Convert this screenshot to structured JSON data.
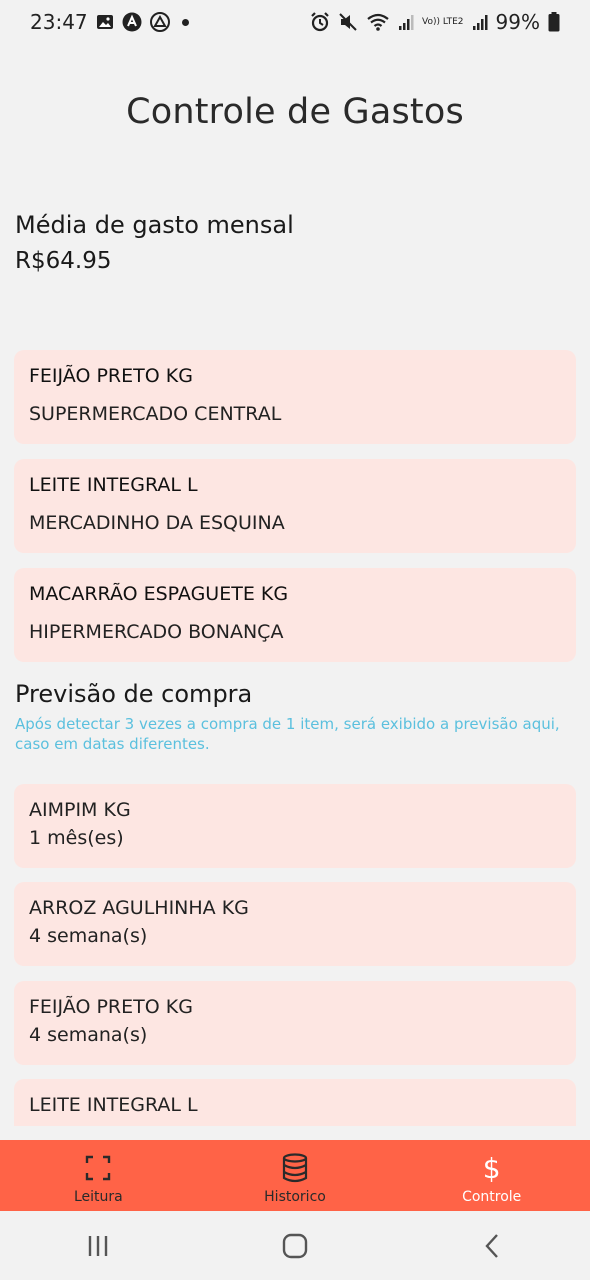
{
  "status_bar": {
    "time": "23:47",
    "battery": "99%",
    "network_label": "Vo)) LTE2"
  },
  "header": {
    "title": "Controle de Gastos"
  },
  "summary": {
    "label": "Média de gasto mensal",
    "value": "R$64.95"
  },
  "top_items": [
    {
      "name": "FEIJÃO PRETO KG",
      "store": "SUPERMERCADO CENTRAL"
    },
    {
      "name": "LEITE INTEGRAL L",
      "store": "MERCADINHO DA ESQUINA"
    },
    {
      "name": "MACARRÃO ESPAGUETE KG",
      "store": "HIPERMERCADO BONANÇA"
    }
  ],
  "prediction": {
    "title": "Previsão de compra",
    "hint": "Após detectar 3 vezes a compra de 1 item, será exibido a previsão aqui, caso em datas diferentes.",
    "items": [
      {
        "name": "AIMPIM KG",
        "period": "1 mês(es)"
      },
      {
        "name": "ARROZ AGULHINHA KG",
        "period": "4 semana(s)"
      },
      {
        "name": "FEIJÃO PRETO KG",
        "period": "4 semana(s)"
      },
      {
        "name": "LEITE INTEGRAL L",
        "period": ""
      }
    ]
  },
  "bottom_nav": [
    {
      "label": "Leitura",
      "icon": "scan-icon"
    },
    {
      "label": "Historico",
      "icon": "database-icon"
    },
    {
      "label": "Controle",
      "icon": "dollar-icon"
    }
  ],
  "colors": {
    "accent": "#ff6347",
    "card": "#fde6e2",
    "hint": "#5bc0de",
    "background": "#f2f2f2"
  }
}
